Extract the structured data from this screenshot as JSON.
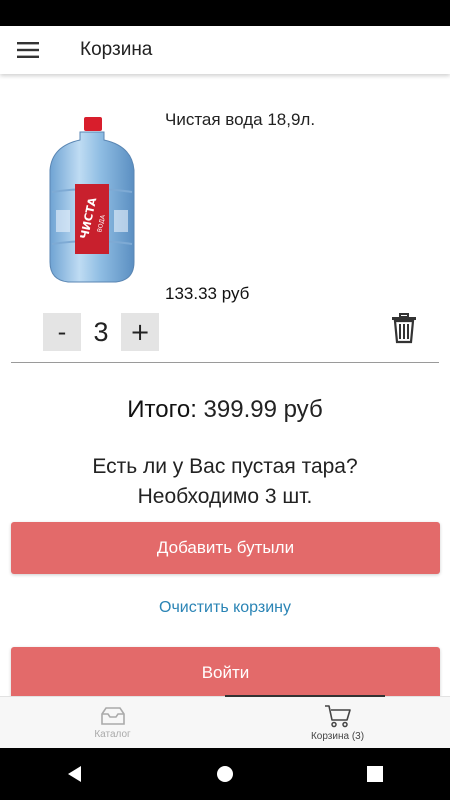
{
  "header": {
    "title": "Корзина",
    "menu_icon": "hamburger-menu-icon"
  },
  "cart_item": {
    "name": "Чистая вода 18,9л.",
    "price": "133.33 руб",
    "quantity": "3",
    "minus_label": "-",
    "plus_label": "+",
    "image_label": "ЧИСТА",
    "image_sublabel": "ВОДА",
    "delete_icon": "trash-icon"
  },
  "summary": {
    "total_label": "Итого:",
    "total_value": "399.99 руб",
    "empty_question_line1": "Есть ли у Вас пустая тара?",
    "empty_question_line2": "Необходимо 3 шт."
  },
  "actions": {
    "add_bottles": "Добавить бутыли",
    "clear_cart": "Очистить корзину",
    "login": "Войти"
  },
  "bottom_nav": {
    "items": [
      {
        "label": "Каталог",
        "icon": "catalog-icon",
        "active": false
      },
      {
        "label": "Корзина (3)",
        "icon": "cart-icon",
        "active": true
      }
    ]
  },
  "colors": {
    "accent_button": "#e36a6a",
    "link": "#2a84b5",
    "qty_button_bg": "#e4e4e4"
  }
}
